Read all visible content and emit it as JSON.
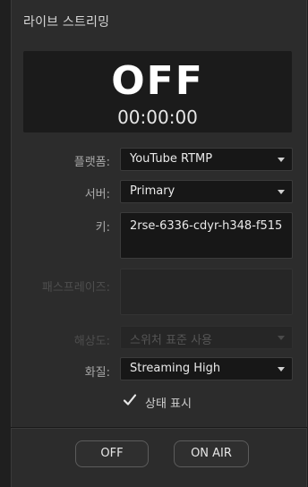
{
  "panel": {
    "title": "라이브 스트리밍"
  },
  "status": {
    "state": "OFF",
    "timecode": "00:00:00"
  },
  "form": {
    "platform": {
      "label": "플랫폼:",
      "value": "YouTube RTMP"
    },
    "server": {
      "label": "서버:",
      "value": "Primary"
    },
    "key": {
      "label": "키:",
      "value": "2rse-6336-cdyr-h348-f515"
    },
    "passphrase": {
      "label": "패스프레이즈:",
      "value": ""
    },
    "resolution": {
      "label": "해상도:",
      "value": "스위처 표준 사용"
    },
    "quality": {
      "label": "화질:",
      "value": "Streaming High"
    },
    "show_status": {
      "label": "상태 표시",
      "checked": true
    }
  },
  "buttons": {
    "off_label": "OFF",
    "on_air_label": "ON AIR"
  },
  "colors": {
    "panel_bg": "#2c2c2c",
    "field_bg": "#171717",
    "status_bg": "#1b1b1b",
    "text_primary": "#eaeaea",
    "text_label": "#a8a8a8",
    "text_disabled": "#4e4e4e"
  }
}
